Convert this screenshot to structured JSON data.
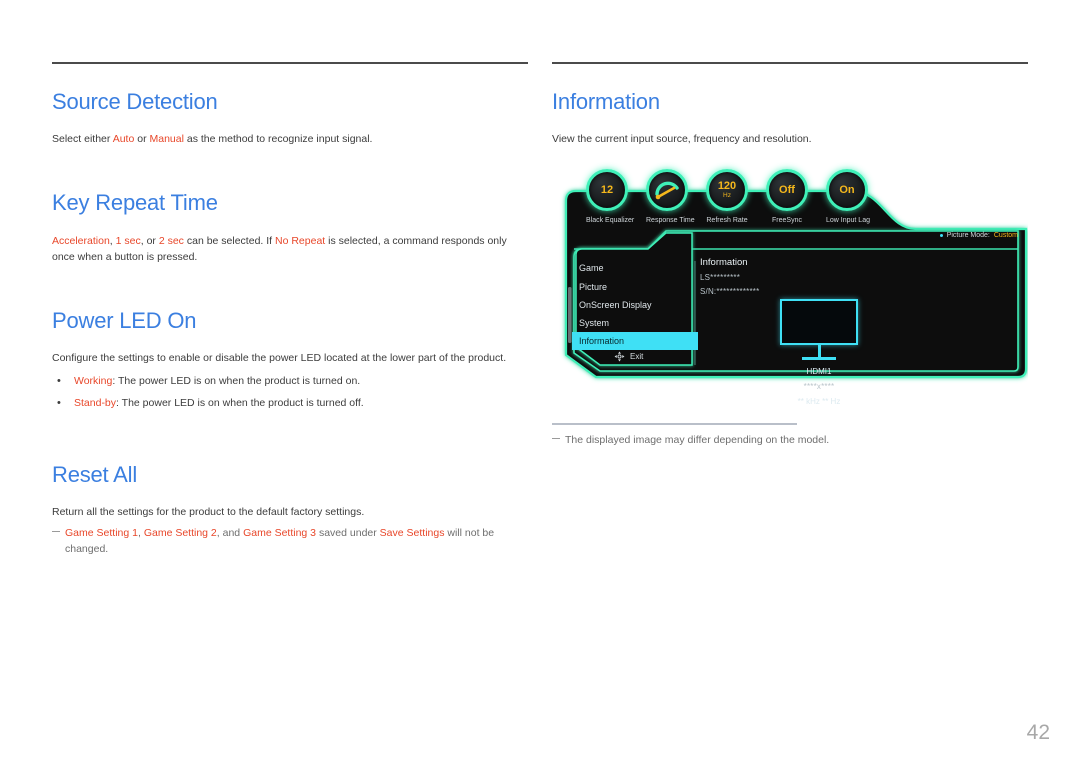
{
  "page": {
    "number": "42"
  },
  "left_column": {
    "sections": [
      {
        "title": "Source Detection",
        "paragraph_parts": [
          {
            "text": "Select either ",
            "style": "normal"
          },
          {
            "text": "Auto",
            "style": "hl"
          },
          {
            "text": " or ",
            "style": "normal"
          },
          {
            "text": "Manual",
            "style": "hl"
          },
          {
            "text": " as the method to recognize input signal.",
            "style": "normal"
          }
        ]
      },
      {
        "title": "Key Repeat Time",
        "paragraph_parts": [
          {
            "text": "Acceleration",
            "style": "hl"
          },
          {
            "text": ", ",
            "style": "normal"
          },
          {
            "text": "1 sec",
            "style": "hl"
          },
          {
            "text": ", or ",
            "style": "normal"
          },
          {
            "text": "2 sec",
            "style": "hl"
          },
          {
            "text": " can be selected. If ",
            "style": "normal"
          },
          {
            "text": "No Repeat",
            "style": "hl"
          },
          {
            "text": " is selected, a command responds only once when a button is pressed.",
            "style": "normal"
          }
        ]
      },
      {
        "title": "Power LED On",
        "paragraph": "Configure the settings to enable or disable the power LED located at the lower part of the product.",
        "bullets": [
          {
            "term": "Working",
            "rest": ": The power LED is on when the product is turned on."
          },
          {
            "term": "Stand-by",
            "rest": ": The power LED is on when the product is turned off."
          }
        ]
      },
      {
        "title": "Reset All",
        "paragraph": "Return all the settings for the product to the default factory settings.",
        "note_parts": [
          {
            "text": "Game Setting 1",
            "style": "hl"
          },
          {
            "text": ", ",
            "style": "gray"
          },
          {
            "text": "Game Setting 2",
            "style": "hl"
          },
          {
            "text": ", and ",
            "style": "gray"
          },
          {
            "text": "Game Setting 3",
            "style": "hl"
          },
          {
            "text": " saved under ",
            "style": "gray"
          },
          {
            "text": "Save Settings",
            "style": "hl"
          },
          {
            "text": " will not be changed.",
            "style": "gray"
          }
        ]
      }
    ]
  },
  "right_column": {
    "section": {
      "title": "Information",
      "paragraph": "View the current input source, frequency and resolution."
    },
    "footnote": "The displayed image may differ depending on the model."
  },
  "osd": {
    "dials": [
      {
        "value": "12",
        "unit": "",
        "label": "Black Equalizer",
        "type": "value"
      },
      {
        "value": "",
        "unit": "",
        "label": "Response Time",
        "type": "gauge"
      },
      {
        "value": "120",
        "unit": "Hz",
        "label": "Refresh Rate",
        "type": "value"
      },
      {
        "value": "Off",
        "unit": "",
        "label": "FreeSync",
        "type": "value"
      },
      {
        "value": "On",
        "unit": "",
        "label": "Low Input Lag",
        "type": "value"
      }
    ],
    "menu_items": [
      {
        "label": "Game",
        "active": false
      },
      {
        "label": "Picture",
        "active": false
      },
      {
        "label": "OnScreen Display",
        "active": false
      },
      {
        "label": "System",
        "active": false
      },
      {
        "label": "Information",
        "active": true
      }
    ],
    "exit_label": "Exit",
    "picture_mode_label": "Picture Mode:",
    "picture_mode_value": "Custom",
    "info_title": "Information",
    "info_model": "LS*********",
    "info_serial": "S/N:*************",
    "input_source": "HDMI1",
    "resolution": "****x****",
    "frequency": "** kHz ** Hz"
  },
  "colors": {
    "heading_blue": "#3b7fe0",
    "highlight_red": "#e8472a",
    "osd_green": "#3ff0b8",
    "osd_cyan": "#3fe0f5",
    "osd_amber": "#f5b81c",
    "rule_gray": "#4b4b4b"
  }
}
